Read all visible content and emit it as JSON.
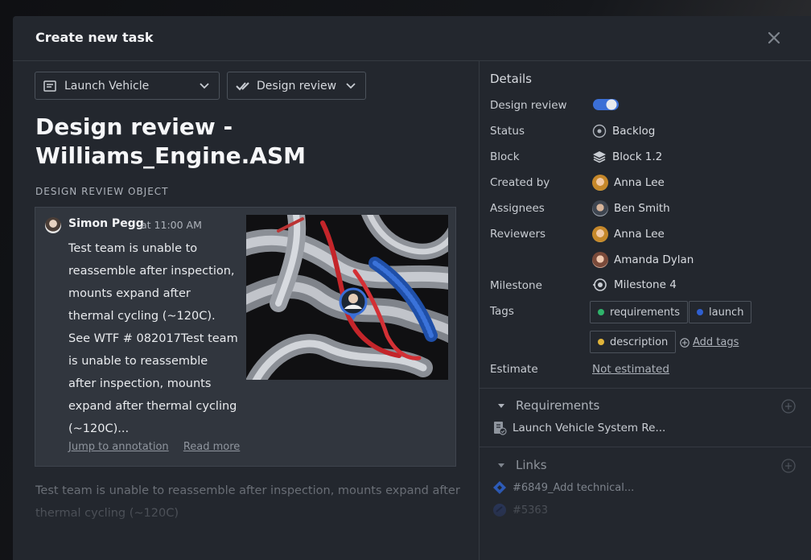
{
  "modal": {
    "title": "Create new task"
  },
  "toolbar": {
    "project_label": "Launch Vehicle",
    "type_label": "Design review"
  },
  "task": {
    "title": "Design review - Williams_Engine.ASM",
    "section_label": "DESIGN REVIEW OBJECT",
    "description": "Test team is unable to reassemble after inspection, mounts expand after thermal cycling (~120C)"
  },
  "comment": {
    "author": "Simon Pegg",
    "time": "at 11:00 AM",
    "text": "Test team is unable to reassemble after inspection, mounts expand after thermal cycling (~120C). See WTF # 082017Test team is unable to reassemble after inspection, mounts expand after thermal cycling (~120C)...",
    "jump_link": "Jump to annotation",
    "read_more_link": "Read more"
  },
  "details": {
    "title": "Details",
    "design_review_label": "Design review",
    "design_review_enabled": true,
    "status_label": "Status",
    "status_value": "Backlog",
    "block_label": "Block",
    "block_value": "Block 1.2",
    "created_by_label": "Created by",
    "created_by_value": "Anna Lee",
    "assignees_label": "Assignees",
    "assignees": [
      "Ben Smith"
    ],
    "reviewers_label": "Reviewers",
    "reviewers": [
      "Anna Lee",
      "Amanda Dylan"
    ],
    "milestone_label": "Milestone",
    "milestone_value": "Milestone 4",
    "tags_label": "Tags",
    "tags": [
      {
        "name": "requirements",
        "color": "#2fb36b"
      },
      {
        "name": "launch",
        "color": "#2f5fd0"
      },
      {
        "name": "description",
        "color": "#e0b43a"
      }
    ],
    "add_tags_label": "Add tags",
    "estimate_label": "Estimate",
    "estimate_value": "Not estimated"
  },
  "requirements": {
    "title": "Requirements",
    "items": [
      "Launch Vehicle System Re..."
    ]
  },
  "links": {
    "title": "Links",
    "items": [
      "#6849_Add technical...",
      "#5363"
    ]
  },
  "colors": {
    "accent": "#3b6fd6",
    "background": "#23272e",
    "card": "#31363e"
  }
}
